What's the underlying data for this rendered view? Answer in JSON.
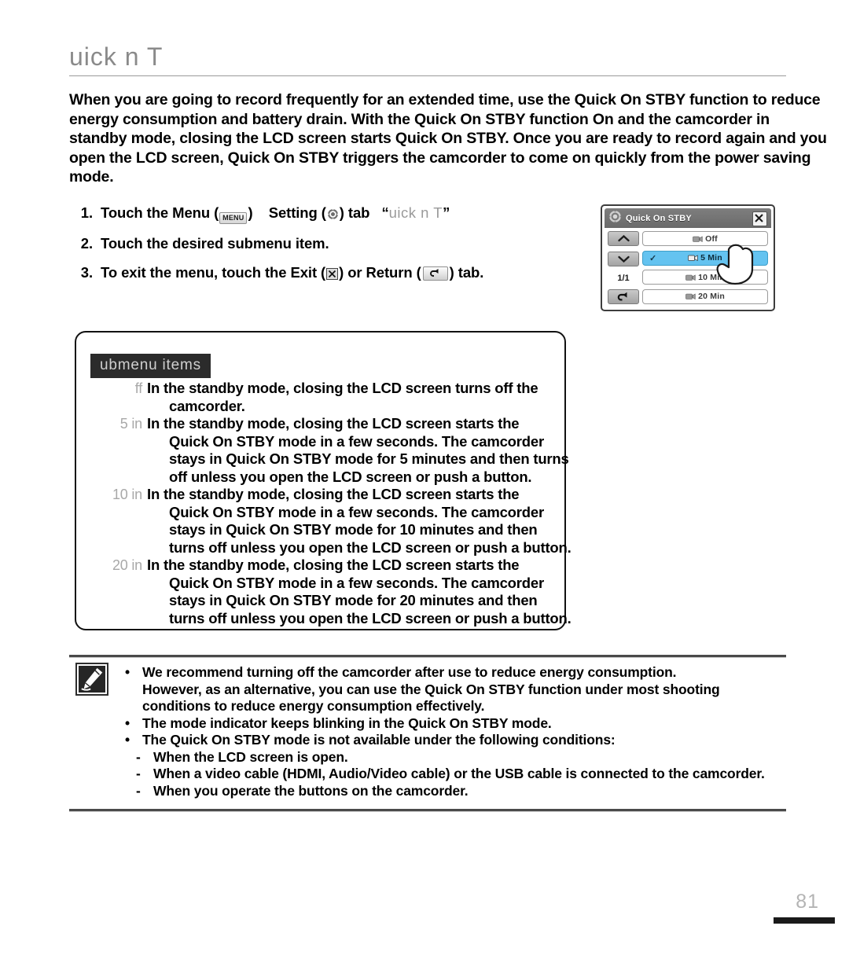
{
  "page": {
    "title": "uick n T",
    "number": "81"
  },
  "intro": "When you are going to record frequently for an extended time, use the Quick On STBY function to reduce energy consumption and battery drain. With the Quick On STBY function On and the camcorder in standby mode, closing the LCD screen starts Quick On STBY. Once you are ready to record again and you open the LCD screen, Quick On STBY triggers the camcorder to come on quickly from the power saving mode.",
  "steps": [
    {
      "num": "1.",
      "pre": "Touch the Menu (",
      "menu_icon_label": "MENU",
      "mid": ")",
      "setting": "Setting (",
      "post": ") tab",
      "quote_open": "“",
      "quoted": "uick n T",
      "quote_close": "”"
    },
    {
      "num": "2.",
      "text": "Touch the desired submenu item."
    },
    {
      "num": "3.",
      "pre": "To exit the menu, touch the Exit (",
      "mid": ") or Return (",
      "post": ") tab."
    }
  ],
  "lcd": {
    "title": "Quick On STBY",
    "gear_icon": "gear-icon",
    "close_icon": "close-icon",
    "page_indicator": "1/1",
    "up_icon": "chevron-up-icon",
    "down_icon": "chevron-down-icon",
    "return_icon": "return-arrow-icon",
    "items": [
      {
        "label": "Off",
        "selected": false
      },
      {
        "label": "5 Min",
        "selected": true
      },
      {
        "label": "10 Min",
        "selected": false
      },
      {
        "label": "20 Min",
        "selected": false
      }
    ],
    "colors": {
      "selected_bg": "#64c3f0",
      "titlebar": "#6f6f6f"
    }
  },
  "submenu": {
    "heading": "ubmenu items",
    "rows": [
      {
        "key": "ff",
        "lines": [
          "In the standby mode, closing the LCD screen turns off the",
          "camcorder."
        ]
      },
      {
        "key": "5 in",
        "lines": [
          "In the standby mode, closing the LCD screen starts the",
          "Quick On STBY mode in a few seconds. The camcorder",
          "stays in Quick On STBY mode for 5 minutes and then turns",
          "off unless you open the LCD screen or push a button."
        ]
      },
      {
        "key": "10 in",
        "lines": [
          "In the standby mode, closing the LCD screen starts the",
          "Quick On STBY mode in a few seconds. The camcorder",
          "stays in Quick On STBY mode for 10 minutes and then",
          "turns off unless you open the LCD screen or push a button."
        ]
      },
      {
        "key": "20 in",
        "lines": [
          "In the standby mode, closing the LCD screen starts the",
          "Quick On STBY mode in a few seconds. The camcorder",
          "stays in Quick On STBY mode for 20 minutes and then",
          "turns off unless you open the LCD screen or push a button."
        ]
      }
    ]
  },
  "notes": {
    "icon": "note-pencil-icon",
    "bullets": [
      {
        "marker": "•",
        "lines": [
          "We recommend turning off the camcorder after use to reduce energy consumption.",
          "However, as an alternative, you can use the Quick On STBY function under most shooting",
          "conditions to reduce energy consumption effectively."
        ]
      },
      {
        "marker": "•",
        "lines": [
          "The mode indicator keeps blinking in the Quick On STBY mode."
        ]
      },
      {
        "marker": "•",
        "lines": [
          "The Quick On STBY mode is not available under the following conditions:"
        ]
      }
    ],
    "sub_items": [
      {
        "marker": "-",
        "text": "When the LCD screen is open."
      },
      {
        "marker": "-",
        "text": "When a video cable (HDMI, Audio/Video cable) or the USB cable is connected to the camcorder."
      },
      {
        "marker": "-",
        "text": "When you operate the buttons on the camcorder."
      }
    ]
  }
}
